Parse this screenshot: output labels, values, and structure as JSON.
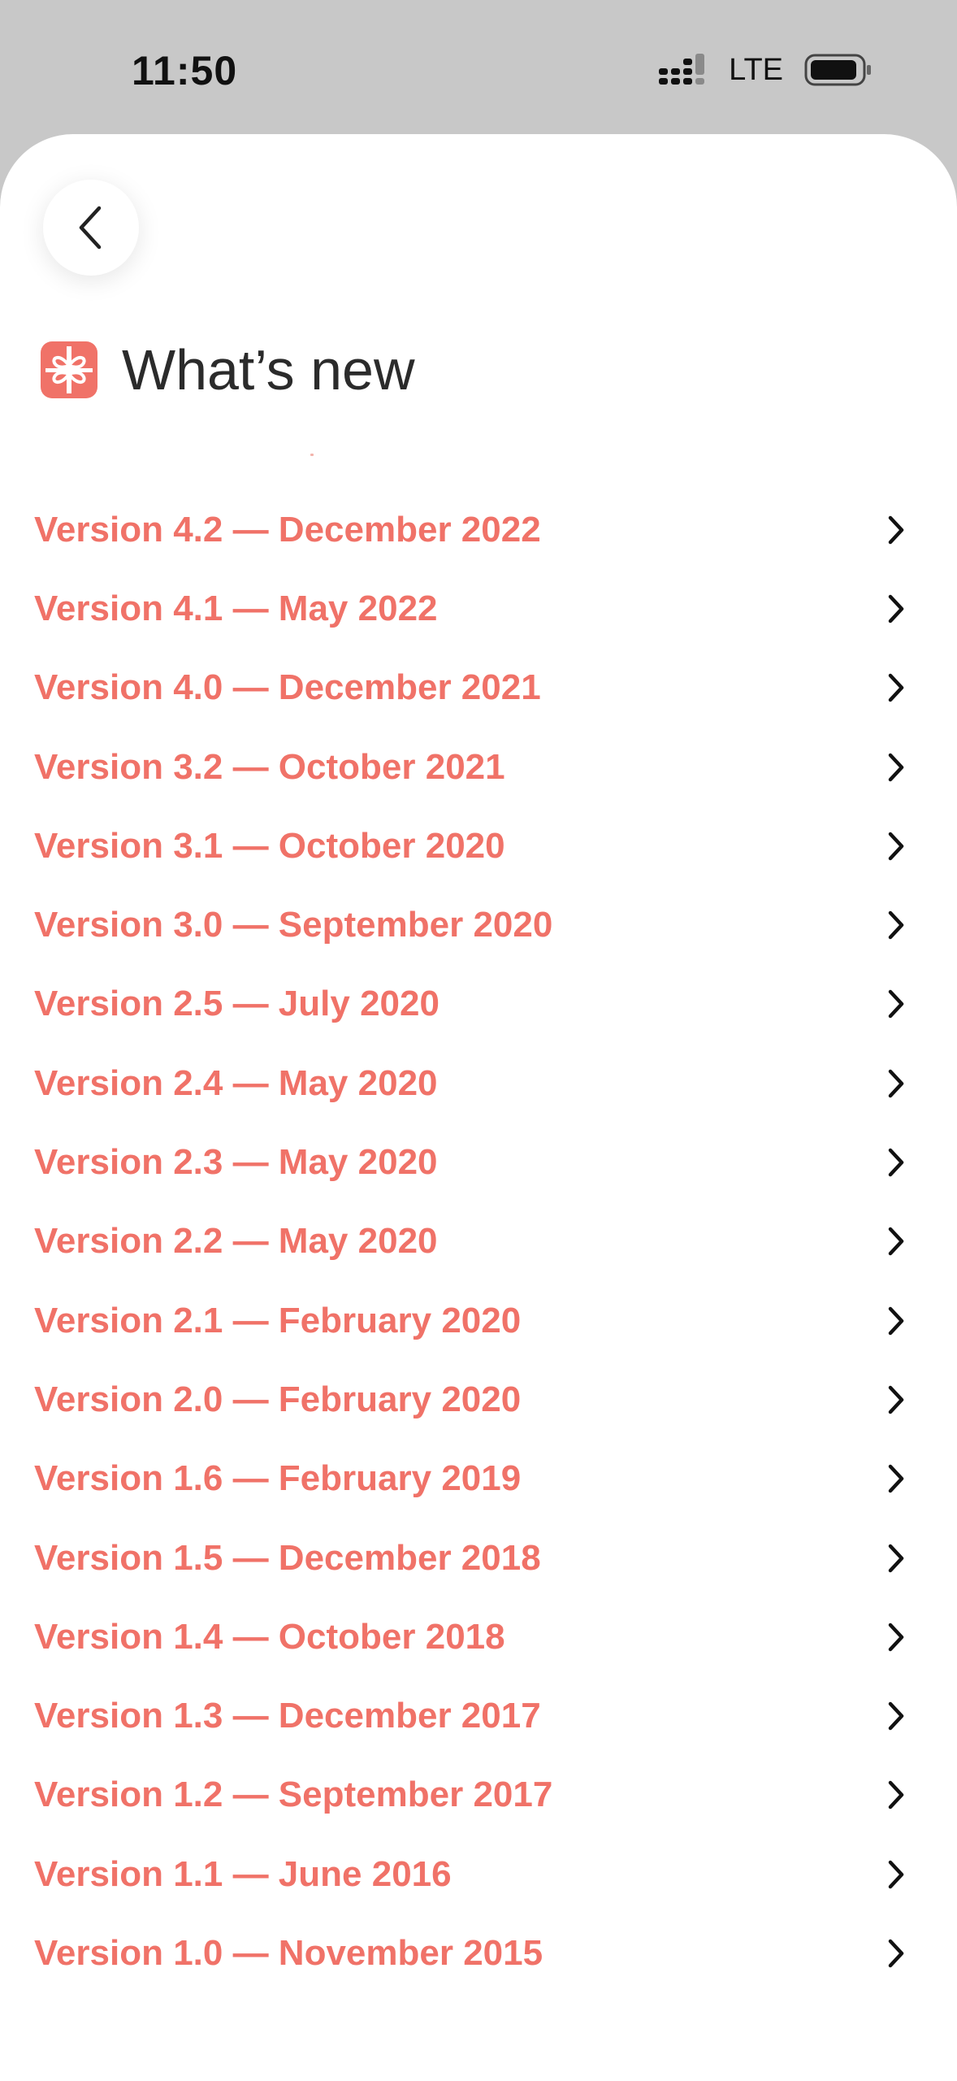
{
  "status_bar": {
    "time": "11:50",
    "network": "LTE",
    "icons": [
      "signal-icon",
      "battery-icon"
    ]
  },
  "header": {
    "back_icon": "chevron-left-icon",
    "title_icon": "gift-icon",
    "title": "What’s new"
  },
  "colors": {
    "accent": "#f07268",
    "title_text": "#2b2b2b",
    "status_bar_bg": "#c8c8c8",
    "sheet_bg": "#ffffff"
  },
  "versions": [
    {
      "label": "Version 4.2 — December 2022"
    },
    {
      "label": "Version 4.1 — May 2022"
    },
    {
      "label": "Version 4.0 — December 2021"
    },
    {
      "label": "Version 3.2 — October 2021"
    },
    {
      "label": "Version 3.1 — October 2020"
    },
    {
      "label": "Version 3.0 — September 2020"
    },
    {
      "label": "Version 2.5 — July 2020"
    },
    {
      "label": "Version 2.4 — May 2020"
    },
    {
      "label": "Version 2.3 — May 2020"
    },
    {
      "label": "Version 2.2 — May 2020"
    },
    {
      "label": "Version 2.1 — February 2020"
    },
    {
      "label": "Version 2.0 — February 2020"
    },
    {
      "label": "Version 1.6 — February 2019"
    },
    {
      "label": "Version 1.5 — December 2018"
    },
    {
      "label": "Version 1.4 — October 2018"
    },
    {
      "label": "Version 1.3 — December 2017"
    },
    {
      "label": "Version 1.2 — September 2017"
    },
    {
      "label": "Version 1.1 — June 2016"
    },
    {
      "label": "Version 1.0 — November 2015"
    }
  ]
}
